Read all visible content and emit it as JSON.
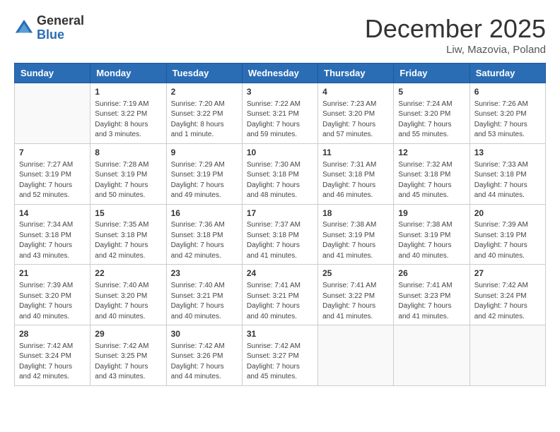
{
  "logo": {
    "general": "General",
    "blue": "Blue"
  },
  "title": "December 2025",
  "location": "Liw, Mazovia, Poland",
  "days_of_week": [
    "Sunday",
    "Monday",
    "Tuesday",
    "Wednesday",
    "Thursday",
    "Friday",
    "Saturday"
  ],
  "weeks": [
    [
      {
        "day": "",
        "info": ""
      },
      {
        "day": "1",
        "info": "Sunrise: 7:19 AM\nSunset: 3:22 PM\nDaylight: 8 hours\nand 3 minutes."
      },
      {
        "day": "2",
        "info": "Sunrise: 7:20 AM\nSunset: 3:22 PM\nDaylight: 8 hours\nand 1 minute."
      },
      {
        "day": "3",
        "info": "Sunrise: 7:22 AM\nSunset: 3:21 PM\nDaylight: 7 hours\nand 59 minutes."
      },
      {
        "day": "4",
        "info": "Sunrise: 7:23 AM\nSunset: 3:20 PM\nDaylight: 7 hours\nand 57 minutes."
      },
      {
        "day": "5",
        "info": "Sunrise: 7:24 AM\nSunset: 3:20 PM\nDaylight: 7 hours\nand 55 minutes."
      },
      {
        "day": "6",
        "info": "Sunrise: 7:26 AM\nSunset: 3:20 PM\nDaylight: 7 hours\nand 53 minutes."
      }
    ],
    [
      {
        "day": "7",
        "info": "Sunrise: 7:27 AM\nSunset: 3:19 PM\nDaylight: 7 hours\nand 52 minutes."
      },
      {
        "day": "8",
        "info": "Sunrise: 7:28 AM\nSunset: 3:19 PM\nDaylight: 7 hours\nand 50 minutes."
      },
      {
        "day": "9",
        "info": "Sunrise: 7:29 AM\nSunset: 3:19 PM\nDaylight: 7 hours\nand 49 minutes."
      },
      {
        "day": "10",
        "info": "Sunrise: 7:30 AM\nSunset: 3:18 PM\nDaylight: 7 hours\nand 48 minutes."
      },
      {
        "day": "11",
        "info": "Sunrise: 7:31 AM\nSunset: 3:18 PM\nDaylight: 7 hours\nand 46 minutes."
      },
      {
        "day": "12",
        "info": "Sunrise: 7:32 AM\nSunset: 3:18 PM\nDaylight: 7 hours\nand 45 minutes."
      },
      {
        "day": "13",
        "info": "Sunrise: 7:33 AM\nSunset: 3:18 PM\nDaylight: 7 hours\nand 44 minutes."
      }
    ],
    [
      {
        "day": "14",
        "info": "Sunrise: 7:34 AM\nSunset: 3:18 PM\nDaylight: 7 hours\nand 43 minutes."
      },
      {
        "day": "15",
        "info": "Sunrise: 7:35 AM\nSunset: 3:18 PM\nDaylight: 7 hours\nand 42 minutes."
      },
      {
        "day": "16",
        "info": "Sunrise: 7:36 AM\nSunset: 3:18 PM\nDaylight: 7 hours\nand 42 minutes."
      },
      {
        "day": "17",
        "info": "Sunrise: 7:37 AM\nSunset: 3:18 PM\nDaylight: 7 hours\nand 41 minutes."
      },
      {
        "day": "18",
        "info": "Sunrise: 7:38 AM\nSunset: 3:19 PM\nDaylight: 7 hours\nand 41 minutes."
      },
      {
        "day": "19",
        "info": "Sunrise: 7:38 AM\nSunset: 3:19 PM\nDaylight: 7 hours\nand 40 minutes."
      },
      {
        "day": "20",
        "info": "Sunrise: 7:39 AM\nSunset: 3:19 PM\nDaylight: 7 hours\nand 40 minutes."
      }
    ],
    [
      {
        "day": "21",
        "info": "Sunrise: 7:39 AM\nSunset: 3:20 PM\nDaylight: 7 hours\nand 40 minutes."
      },
      {
        "day": "22",
        "info": "Sunrise: 7:40 AM\nSunset: 3:20 PM\nDaylight: 7 hours\nand 40 minutes."
      },
      {
        "day": "23",
        "info": "Sunrise: 7:40 AM\nSunset: 3:21 PM\nDaylight: 7 hours\nand 40 minutes."
      },
      {
        "day": "24",
        "info": "Sunrise: 7:41 AM\nSunset: 3:21 PM\nDaylight: 7 hours\nand 40 minutes."
      },
      {
        "day": "25",
        "info": "Sunrise: 7:41 AM\nSunset: 3:22 PM\nDaylight: 7 hours\nand 41 minutes."
      },
      {
        "day": "26",
        "info": "Sunrise: 7:41 AM\nSunset: 3:23 PM\nDaylight: 7 hours\nand 41 minutes."
      },
      {
        "day": "27",
        "info": "Sunrise: 7:42 AM\nSunset: 3:24 PM\nDaylight: 7 hours\nand 42 minutes."
      }
    ],
    [
      {
        "day": "28",
        "info": "Sunrise: 7:42 AM\nSunset: 3:24 PM\nDaylight: 7 hours\nand 42 minutes."
      },
      {
        "day": "29",
        "info": "Sunrise: 7:42 AM\nSunset: 3:25 PM\nDaylight: 7 hours\nand 43 minutes."
      },
      {
        "day": "30",
        "info": "Sunrise: 7:42 AM\nSunset: 3:26 PM\nDaylight: 7 hours\nand 44 minutes."
      },
      {
        "day": "31",
        "info": "Sunrise: 7:42 AM\nSunset: 3:27 PM\nDaylight: 7 hours\nand 45 minutes."
      },
      {
        "day": "",
        "info": ""
      },
      {
        "day": "",
        "info": ""
      },
      {
        "day": "",
        "info": ""
      }
    ]
  ]
}
